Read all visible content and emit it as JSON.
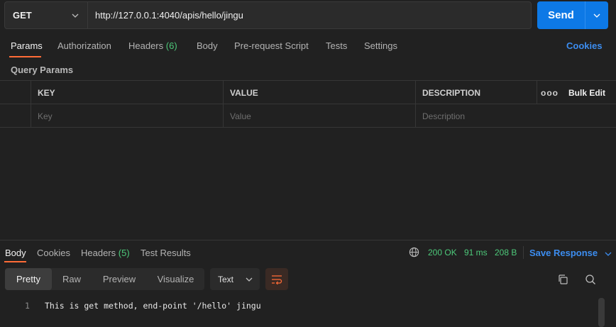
{
  "request": {
    "method": "GET",
    "url": "http://127.0.0.1:4040/apis/hello/jingu",
    "send_label": "Send"
  },
  "request_tabs": [
    {
      "label": "Params",
      "active": true
    },
    {
      "label": "Authorization"
    },
    {
      "label": "Headers",
      "count": "(6)"
    },
    {
      "label": "Body"
    },
    {
      "label": "Pre-request Script"
    },
    {
      "label": "Tests"
    },
    {
      "label": "Settings"
    }
  ],
  "cookies_link": "Cookies",
  "query_params": {
    "title": "Query Params",
    "columns": [
      "KEY",
      "VALUE",
      "DESCRIPTION"
    ],
    "more_label": "ooo",
    "bulk_edit_label": "Bulk Edit",
    "placeholders": {
      "key": "Key",
      "value": "Value",
      "description": "Description"
    }
  },
  "response": {
    "tabs": [
      {
        "label": "Body",
        "active": true
      },
      {
        "label": "Cookies"
      },
      {
        "label": "Headers",
        "count": "(5)"
      },
      {
        "label": "Test Results"
      }
    ],
    "status": "200 OK",
    "time": "91 ms",
    "size": "208 B",
    "save_label": "Save Response",
    "view_modes": [
      "Pretty",
      "Raw",
      "Preview",
      "Visualize"
    ],
    "active_view": "Pretty",
    "format": "Text",
    "lines": [
      {
        "number": "1",
        "text": "This is get method, end-point '/hello' jingu"
      }
    ]
  },
  "colors": {
    "accent": "#ff6c37",
    "primary": "#0d79e6",
    "link": "#3c8df0",
    "success": "#4dc97a",
    "background": "#212121"
  },
  "icons": [
    "chevron-down-icon",
    "globe-icon",
    "wrap-lines-icon",
    "copy-icon",
    "search-icon"
  ]
}
